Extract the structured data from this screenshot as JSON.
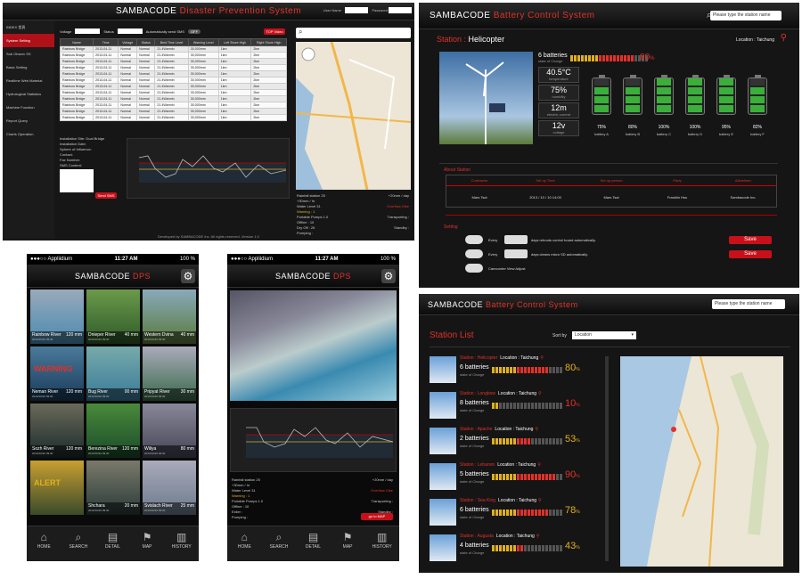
{
  "colors": {
    "accent": "#e0322a",
    "green": "#3ab03a",
    "yellow": "#e0b020"
  },
  "panelA": {
    "brand": "SAMBACODE",
    "app": "Disaster Prevention System",
    "login": {
      "user": "User Name",
      "pass": "Password"
    },
    "sidebar": [
      "INDEX 首頁",
      "System Setting",
      "Sub Observ SS",
      "Basic Setting",
      "Realtime Web Material",
      "Hydrological Statistics",
      "Machine Function",
      "Report Query",
      "Charts Operation"
    ],
    "filters": {
      "voltage": "Voltage",
      "status": "Status",
      "auto": "Automatically send SMS",
      "toggle": "OFF",
      "btn": "TOP Video"
    },
    "cols": [
      "Name",
      "Time",
      "Voltage",
      "Status",
      "Best Time Level",
      "Warning Level",
      "Left Shore High",
      "Right Shore High"
    ],
    "rows": [
      [
        "Rainbow Bridge",
        "2013-04-11",
        "Normal",
        "Normal",
        "21.4Warmin",
        "30,000mm",
        "1km",
        "2km"
      ],
      [
        "Rainbow Bridge",
        "2013-04-11",
        "Normal",
        "Normal",
        "21.4Warmin",
        "30,000mm",
        "1km",
        "2km"
      ],
      [
        "Rainbow Bridge",
        "2013-04-11",
        "Normal",
        "Normal",
        "21.4Warmin",
        "30,000mm",
        "1km",
        "2km"
      ],
      [
        "Rainbow Bridge",
        "2013-04-11",
        "Normal",
        "Normal",
        "21.4Warmin",
        "30,000mm",
        "1km",
        "2km"
      ],
      [
        "Rainbow Bridge",
        "2013-04-11",
        "Normal",
        "Normal",
        "21.4Warmin",
        "30,000mm",
        "1km",
        "2km"
      ],
      [
        "Rainbow Bridge",
        "2013-04-11",
        "Normal",
        "Normal",
        "21.4Warmin",
        "30,000mm",
        "1km",
        "2km"
      ],
      [
        "Rainbow Bridge",
        "2013-04-11",
        "Normal",
        "Normal",
        "21.4Warmin",
        "30,000mm",
        "1km",
        "2km"
      ],
      [
        "Rainbow Bridge",
        "2013-04-11",
        "Normal",
        "Normal",
        "21.4Warmin",
        "30,000mm",
        "1km",
        "2km"
      ],
      [
        "Rainbow Bridge",
        "2013-04-11",
        "Normal",
        "Normal",
        "21.4Warmin",
        "30,000mm",
        "1km",
        "2km"
      ],
      [
        "Rainbow Bridge",
        "2013-04-11",
        "Normal",
        "Normal",
        "21.4Warmin",
        "30,000mm",
        "1km",
        "2km"
      ],
      [
        "Rainbow Bridge",
        "2013-04-11",
        "Normal",
        "Normal",
        "21.4Warmin",
        "30,000mm",
        "1km",
        "2km"
      ],
      [
        "Rainbow Bridge",
        "2013-04-11",
        "Normal",
        "Normal",
        "21.4Warmin",
        "30,000mm",
        "1km",
        "2km"
      ]
    ],
    "form": [
      "Installation Site: Dual Bridge",
      "Installation Date:",
      "Sphere of Influence:",
      "Contact:",
      "Fax Number:",
      "SMS Content:"
    ],
    "send": "Send SMS",
    "info": [
      "Rainfall station 25",
      "+30mm / hr",
      "Water Level 31",
      "Warning : 1",
      "Portable Pumps 1.0",
      "Offline : 10",
      "Dry Off : 26",
      "Pumping :"
    ],
    "info_right": [
      "+20mm / day",
      "Overflow Dike",
      "Transporting :",
      "Standby :"
    ],
    "footer": "Developed by SAMBACODE Inc. All rights reserved. Version 1.0"
  },
  "panelB": {
    "brand": "SAMBACODE",
    "app": "Battery Control System",
    "search": "Please type the station name",
    "station_label": "Station",
    "station": "Helicopter",
    "location": "Location : Taichung",
    "batteries": "6 batteries",
    "soc": "state of Charge",
    "pct": "80",
    "stats": [
      {
        "v": "40.5°C",
        "l": "temperature"
      },
      {
        "v": "75%",
        "l": "humidity"
      },
      {
        "v": "12m",
        "l": "electric current"
      },
      {
        "v": "12v",
        "l": "voltage"
      }
    ],
    "bats": [
      {
        "p": "75%",
        "n": "battery A",
        "f": 0.75
      },
      {
        "p": "80%",
        "n": "battery B",
        "f": 0.8
      },
      {
        "p": "100%",
        "n": "battery C",
        "f": 1
      },
      {
        "p": "100%",
        "n": "battery D",
        "f": 1
      },
      {
        "p": "95%",
        "n": "battery E",
        "f": 0.95
      },
      {
        "p": "82%",
        "n": "battery F",
        "f": 0.82
      }
    ],
    "about": "About Station",
    "about_cols": [
      "Contractor",
      "Set up Time",
      "Set up person",
      "Party",
      "Advertiser"
    ],
    "about_row": [
      "Mars Tsai",
      "2013 / 10 / 10  14:00",
      "Mars Tsai",
      "Franklin Hsu",
      "Sambacode Inc."
    ],
    "setting": "Setting",
    "set1": "days reboots control board automatically.",
    "set2": "days cleans micro SD automatically.",
    "set3": "Camcorder View Adjust",
    "every": "Every",
    "save": "Save"
  },
  "phone1": {
    "carrier": "●●●○○ Appliidium",
    "time": "11:27 AM",
    "battery": "100 %",
    "brand": "SAMBACODE",
    "app": "DPS",
    "tiles": [
      {
        "n": "Rainbow River",
        "v": "120 mm",
        "d": "2013/10/10 09:30"
      },
      {
        "n": "Dnieper River",
        "v": "40 mm",
        "d": "2013/10/10 09:30"
      },
      {
        "n": "Western Dvina",
        "v": "40 mm",
        "d": "2013/10/10 09:30"
      },
      {
        "n": "Neman River",
        "v": "120 mm",
        "d": "2013/10/10 09:30",
        "w": "WARNING"
      },
      {
        "n": "Bug River",
        "v": "00 mm",
        "d": "2013/10/10 09:30"
      },
      {
        "n": "Pripyat River",
        "v": "30 mm",
        "d": "2013/10/10 09:30"
      },
      {
        "n": "Sozh River",
        "v": "120 mm",
        "d": "2013/10/10 09:30"
      },
      {
        "n": "Berezina River",
        "v": "120 mm",
        "d": "2013/10/10 09:30"
      },
      {
        "n": "Wiliya",
        "v": "80 mm",
        "d": "2013/10/10 09:30"
      },
      {
        "n": "",
        "v": "",
        "d": "",
        "w": "ALERT"
      },
      {
        "n": "Shchara",
        "v": "20 mm",
        "d": "2013/10/10 09:30"
      },
      {
        "n": "Svislach River",
        "v": "25 mm",
        "d": "2013/10/10 09:30"
      }
    ],
    "tabs": [
      "HOME",
      "SEARCH",
      "DETAIL",
      "MAP",
      "HISTORY"
    ]
  },
  "phone2": {
    "carrier": "●●●○○ Appliidium",
    "time": "11:27 AM",
    "battery": "100 %",
    "brand": "SAMBACODE",
    "app": "DPS",
    "info": [
      "Rainfall station 25",
      "+30mm / hr",
      "Water Level 31",
      "Warning : 1",
      "Portable Pumps 1.0",
      "Offline : 10",
      "Exiler :",
      "Pumping :"
    ],
    "info_right": [
      "+20mm / day",
      "Overflow Dike",
      "Transporting :",
      "Standby :"
    ],
    "map_btn": "go to MAP",
    "tabs": [
      "HOME",
      "SEARCH",
      "DETAIL",
      "MAP",
      "HISTORY"
    ]
  },
  "panelE": {
    "brand": "SAMBACODE",
    "app": "Battery Control System",
    "search": "Please type the station name",
    "title": "Station List",
    "sort": "Sort by",
    "sort_value": "Location",
    "rows": [
      {
        "s": "Station : Helicopter",
        "loc": "Location : Taichung",
        "b": "6 batteries",
        "p": "80",
        "f": 0.8
      },
      {
        "s": "Station : Longbow",
        "loc": "Location : Taichung",
        "b": "8 batteries",
        "p": "10",
        "f": 0.1
      },
      {
        "s": "Station : Apache",
        "loc": "Location : Taichung",
        "b": "2 batteries",
        "p": "53",
        "f": 0.53
      },
      {
        "s": "Station : Lebanon",
        "loc": "Location : Taichung",
        "b": "5 batteries",
        "p": "90",
        "f": 0.9
      },
      {
        "s": "Station : Sea King",
        "loc": "Location : Taichung",
        "b": "6 batteries",
        "p": "78",
        "f": 0.78
      },
      {
        "s": "Station : Augusta",
        "loc": "Location : Taichung",
        "b": "4 batteries",
        "p": "43",
        "f": 0.43
      }
    ],
    "soc": "state of Charge"
  }
}
